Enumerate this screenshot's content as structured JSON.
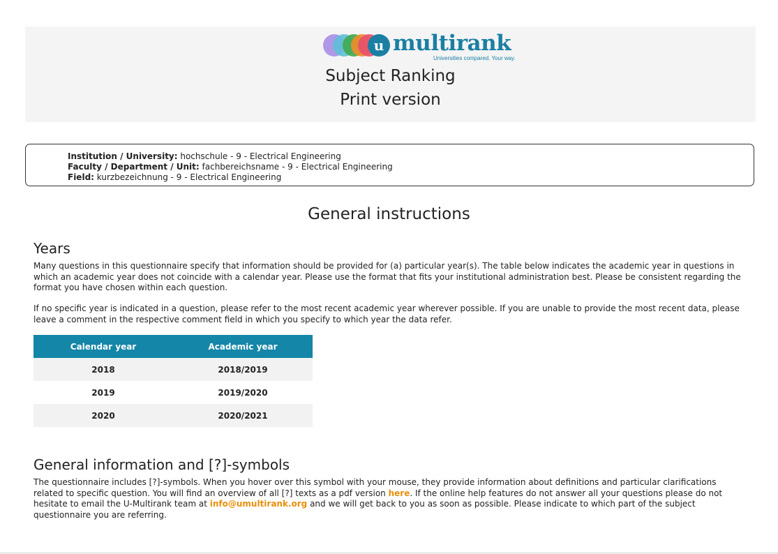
{
  "header": {
    "logo_text": "multirank",
    "logo_letter": "u",
    "logo_tagline": "Universities compared. Your way.",
    "title": "Subject Ranking",
    "subtitle": "Print version",
    "logo_colors": [
      "#a98ee6",
      "#5ec0d6",
      "#3fa84f",
      "#f28c2a",
      "#e8506e",
      "#1a7fa3"
    ]
  },
  "info": {
    "institution_label": "Institution / University:",
    "institution_value": " hochschule - 9 - Electrical Engineering",
    "faculty_label": "Faculty / Department / Unit:",
    "faculty_value": " fachbereichsname - 9 - Electrical Engineering",
    "field_label": "Field:",
    "field_value": " kurzbezeichnung - 9 - Electrical Engineering"
  },
  "main_heading": "General instructions",
  "years": {
    "heading": "Years",
    "para1": "Many questions in this questionnaire specify that information should be provided for (a) particular year(s). The table below indicates the academic year in questions in which an academic year does not coincide with a calendar year. Please use the format that fits your institutional administration best. Please be consistent regarding the format you have chosen within each question.",
    "para2": "If no specific year is indicated in a question, please refer to the most recent academic year wherever possible. If you are unable to provide the most recent data, please leave a comment in the respective comment field in which you specify to which year the data refer.",
    "table": {
      "headers": [
        "Calendar year",
        "Academic year"
      ],
      "rows": [
        [
          "2018",
          "2018/2019"
        ],
        [
          "2019",
          "2019/2020"
        ],
        [
          "2020",
          "2020/2021"
        ]
      ]
    }
  },
  "general": {
    "heading": "General information and [?]-symbols",
    "text_a": "The questionnaire includes [?]-symbols. When you hover over this symbol with your mouse, they provide information about definitions and particular clarifications related to specific question. You will find an overview of all [?] texts as a pdf version ",
    "link_here": "here",
    "text_b": ". If the online help features do not answer all your questions please do not hesitate to email the U-Multirank team at ",
    "link_email": "info@umultirank.org",
    "text_c": " and we will get back to you as soon as possible. Please indicate to which part of the subject questionnaire you are referring."
  }
}
